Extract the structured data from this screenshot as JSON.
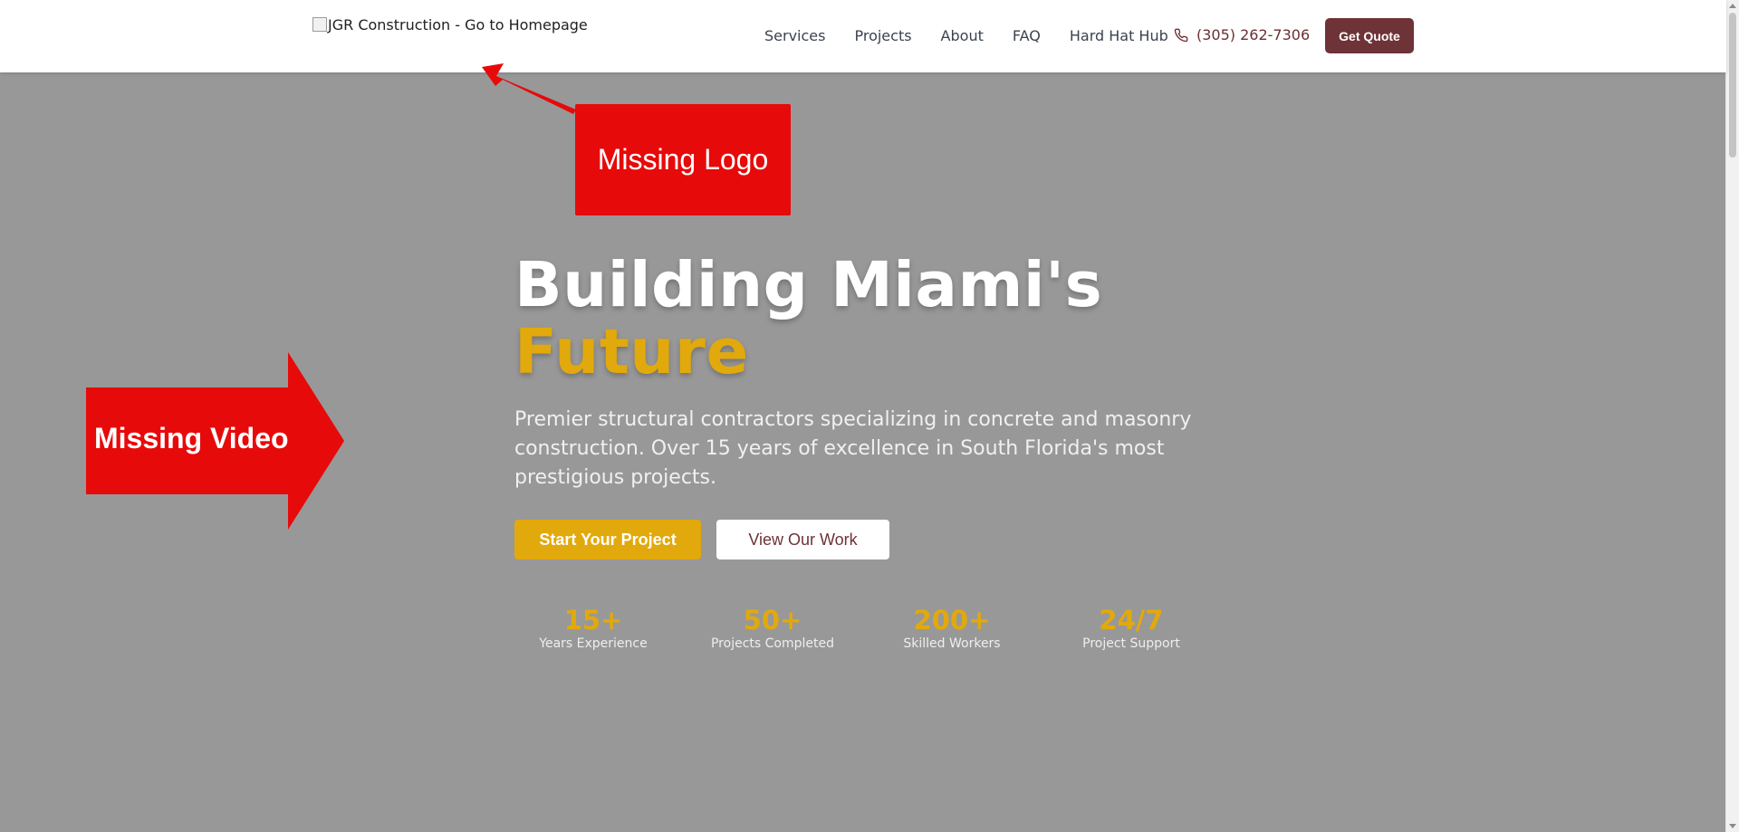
{
  "header": {
    "logo_alt": "JGR Construction - Go to Homepage",
    "nav": [
      "Services",
      "Projects",
      "About",
      "FAQ",
      "Hard Hat Hub"
    ],
    "phone": "(305) 262-7306",
    "cta": "Get Quote",
    "icons": {
      "phone": "phone-icon",
      "logo": "broken-image-icon"
    }
  },
  "hero": {
    "title_line1": "Building Miami's",
    "title_line2": "Future",
    "subtitle": "Premier structural contractors specializing in concrete and masonry construction. Over 15 years of excellence in South Florida's most prestigious projects.",
    "primary_button": "Start Your Project",
    "secondary_button": "View Our Work",
    "stats": [
      {
        "value": "15+",
        "label": "Years Experience"
      },
      {
        "value": "50+",
        "label": "Projects Completed"
      },
      {
        "value": "200+",
        "label": "Skilled Workers"
      },
      {
        "value": "24/7",
        "label": "Project Support"
      }
    ]
  },
  "annotations": {
    "logo_note": "Missing Logo",
    "video_note": "Missing Video"
  },
  "colors": {
    "brand_maroon": "#6e3337",
    "accent_gold": "#e2a90c",
    "overlay_gray": "#989898",
    "annotation_red": "#e70a0a"
  }
}
